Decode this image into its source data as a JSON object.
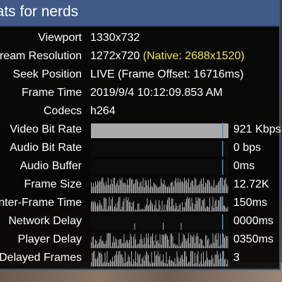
{
  "title": "Stats for nerds",
  "info_rows": [
    {
      "label": "Viewport",
      "value": "1330x732"
    },
    {
      "label": "Stream Resolution",
      "value": "1272x720 ",
      "extra": "(Native: 2688x1520)"
    },
    {
      "label": "Seek Position",
      "value": "LIVE (Frame Offset: 16716ms)"
    },
    {
      "label": "Frame Time",
      "value": "2019/9/4 10:12:09.853 AM"
    },
    {
      "label": "Codecs",
      "value": "h264"
    }
  ],
  "graph_rows": [
    {
      "label": "Video Bit Rate",
      "value": "921 Kbps",
      "style": "full",
      "level": 0.95
    },
    {
      "label": "Audio Bit Rate",
      "value": "0 bps",
      "style": "empty",
      "level": 0
    },
    {
      "label": "Audio Buffer",
      "value": "0ms",
      "style": "empty",
      "level": 0
    },
    {
      "label": "Frame Size",
      "value": "12.72K",
      "style": "noisy-high",
      "level": 0.7
    },
    {
      "label": "Inter-Frame Time",
      "value": "150ms",
      "style": "noisy-low",
      "level": 0.5
    },
    {
      "label": "Network Delay",
      "value": "0000ms",
      "style": "sparse",
      "level": 0.1
    },
    {
      "label": "Player Delay",
      "value": "0350ms",
      "style": "noisy-mid",
      "level": 0.55
    },
    {
      "label": "Delayed Frames",
      "value": "3",
      "style": "noisy-mid",
      "level": 0.6
    }
  ],
  "colors": {
    "title_bg": "#3f5a86",
    "native_text": "#f2e35a",
    "graph_fill": "#a9a9a9",
    "cursor_line": "#4a90d9"
  }
}
